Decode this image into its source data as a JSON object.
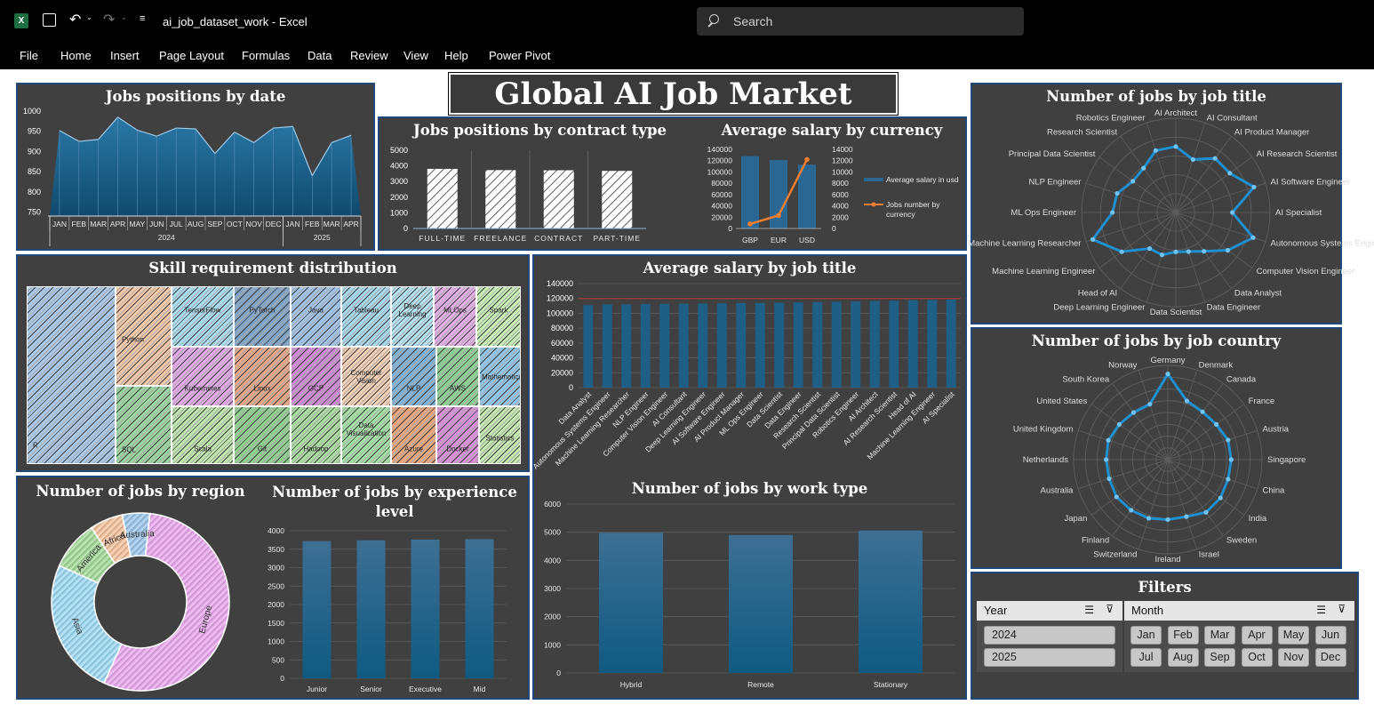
{
  "titlebar": {
    "filename": "ai_job_dataset_work",
    "separator": "-",
    "app": "Excel",
    "search_placeholder": "Search"
  },
  "ribbon": {
    "tabs": [
      "File",
      "Home",
      "Insert",
      "Page Layout",
      "Formulas",
      "Data",
      "Review",
      "View",
      "Help",
      "Power Pivot"
    ]
  },
  "dashboard_title": "Global AI Job Market",
  "panels": {
    "date": "Jobs positions by date",
    "contract": "Jobs positions by contract type",
    "currency": "Average salary by currency",
    "title_radar": "Number of jobs by job title",
    "skills": "Skill requirement distribution",
    "salary_title": "Average salary by job title",
    "country": "Number of jobs by job country",
    "region": "Number of jobs by region",
    "experience": "Number of jobs by experience level",
    "worktype": "Number of jobs by work type",
    "filters": "Filters"
  },
  "slicers": {
    "year": {
      "label": "Year",
      "items": [
        "2024",
        "2025"
      ]
    },
    "month": {
      "label": "Month",
      "items": [
        "Jan",
        "Feb",
        "Mar",
        "Apr",
        "May",
        "Jun",
        "Jul",
        "Aug",
        "Sep",
        "Oct",
        "Nov",
        "Dec"
      ]
    }
  },
  "chart_data": [
    {
      "id": "date",
      "type": "area",
      "title": "Jobs positions by date",
      "categories": [
        "JAN",
        "FEB",
        "MAR",
        "APR",
        "MAY",
        "JUN",
        "JUL",
        "AUG",
        "SEP",
        "OCT",
        "NOV",
        "DEC",
        "JAN",
        "FEB",
        "MAR",
        "APR"
      ],
      "groups": [
        "2024",
        "2025"
      ],
      "values": [
        952,
        925,
        930,
        985,
        953,
        938,
        958,
        956,
        895,
        948,
        922,
        958,
        962,
        840,
        922,
        940
      ],
      "yticks": [
        1000,
        950,
        900,
        850,
        800,
        750
      ],
      "ylim": [
        740,
        1000
      ]
    },
    {
      "id": "contract",
      "type": "bar",
      "title": "Jobs positions by contract type",
      "categories": [
        "FULL-TIME",
        "FREELANCE",
        "CONTRACT",
        "PART-TIME"
      ],
      "values": [
        3810,
        3730,
        3720,
        3680
      ],
      "yticks": [
        5000,
        4000,
        3000,
        2000,
        1000,
        0
      ],
      "ylim": [
        0,
        5000
      ]
    },
    {
      "id": "currency",
      "type": "bar",
      "title": "Average salary by currency",
      "categories": [
        "GBP",
        "EUR",
        "USD"
      ],
      "series": [
        {
          "name": "Average salary in usd",
          "values": [
            128000,
            121000,
            113000
          ]
        },
        {
          "name": "Jobs number by currency",
          "values": [
            800,
            2300,
            12200
          ]
        }
      ],
      "yticks": [
        "140000",
        "120000",
        "100000",
        "80000",
        "60000",
        "40000",
        "20000",
        "0"
      ],
      "y2ticks": [
        "14000",
        "12000",
        "10000",
        "8000",
        "6000",
        "4000",
        "2000",
        "0"
      ],
      "ylim": [
        0,
        140000
      ],
      "y2lim": [
        0,
        14000
      ]
    },
    {
      "id": "title_radar",
      "type": "radar",
      "title": "Number of jobs by job title",
      "categories": [
        "AI Architect",
        "AI Consultant",
        "AI Product Manager",
        "AI Research Scientist",
        "AI Software Engineer",
        "AI Specialist",
        "Autonomous Systems Engineer",
        "Computer Vision Engineer",
        "Data Analyst",
        "Data Engineer",
        "Data Scientist",
        "Deep Learning Engineer",
        "Head of AI",
        "Machine Learning Engineer",
        "Machine Learning Researcher",
        "ML Ops Engineer",
        "NLP Engineer",
        "Principal Data Scientist",
        "Research Scientist",
        "Robotics Engineer"
      ],
      "values": [
        770,
        650,
        780,
        780,
        960,
        660,
        950,
        750,
        560,
        480,
        460,
        520,
        520,
        780,
        1020,
        740,
        720,
        620,
        640,
        760
      ],
      "rmax": 1100
    },
    {
      "id": "skills",
      "type": "treemap",
      "title": "Skill requirement distribution",
      "categories": [
        "R",
        "Python",
        "SQL",
        "TensorFlow",
        "PyTorch",
        "Java",
        "Tableau",
        "Deep Learning",
        "MLOps",
        "Spark",
        "Kubernetes",
        "Linux",
        "GCP",
        "Computer Vision",
        "NLP",
        "AWS",
        "Mathematics",
        "Scala",
        "Git",
        "Hadoop",
        "Data Visualization",
        "Azure",
        "Docker",
        "Statistics"
      ]
    },
    {
      "id": "salary_title",
      "type": "bar",
      "title": "Average salary by job title",
      "categories": [
        "Data Analyst",
        "Autonomous Systems Engineer",
        "Machine Learning Researcher",
        "NLP Engineer",
        "Computer Vision Engineer",
        "AI Consultant",
        "Deep Learning Engineer",
        "AI Software Engineer",
        "AI Product Manager",
        "ML Ops Engineer",
        "Data Scientist",
        "Data Engineer",
        "Research Scientist",
        "Principal Data Scientist",
        "Robotics Engineer",
        "AI Architect",
        "AI Research Scientist",
        "Head of AI",
        "Machine Learning Engineer",
        "AI Specialist"
      ],
      "values": [
        111000,
        112000,
        112200,
        112500,
        112800,
        113000,
        113200,
        113500,
        113800,
        114000,
        114300,
        114600,
        115000,
        115500,
        116000,
        116500,
        117000,
        117500,
        118000,
        118500
      ],
      "yticks": [
        "140000",
        "120000",
        "100000",
        "80000",
        "60000",
        "40000",
        "20000",
        "0"
      ],
      "ylim": [
        0,
        140000
      ]
    },
    {
      "id": "country",
      "type": "radar",
      "title": "Number of jobs by job country",
      "categories": [
        "Germany",
        "Denmark",
        "Canada",
        "France",
        "Austria",
        "Singapore",
        "China",
        "India",
        "Sweden",
        "Israel",
        "Ireland",
        "Switzerland",
        "Finland",
        "Japan",
        "Australia",
        "Netherlands",
        "United Kingdom",
        "United States",
        "South Korea",
        "Norway"
      ],
      "values": [
        1000,
        720,
        690,
        700,
        740,
        740,
        740,
        760,
        760,
        700,
        700,
        720,
        730,
        740,
        720,
        720,
        730,
        700,
        680,
        680
      ],
      "rmax": 1100
    },
    {
      "id": "region",
      "type": "pie",
      "title": "Number of jobs by region",
      "categories": [
        "Europe",
        "Asia",
        "America",
        "Africa",
        "Australia"
      ],
      "values": [
        55,
        25,
        9,
        6,
        5
      ]
    },
    {
      "id": "experience",
      "type": "bar",
      "title": "Number of jobs by experience level",
      "categories": [
        "Junior",
        "Senior",
        "Executive",
        "Mid"
      ],
      "values": [
        3720,
        3740,
        3760,
        3770
      ],
      "yticks": [
        "4000",
        "3500",
        "3000",
        "2500",
        "2000",
        "1500",
        "1000",
        "500",
        "0"
      ],
      "ylim": [
        0,
        4000
      ]
    },
    {
      "id": "worktype",
      "type": "bar",
      "title": "Number of jobs by work type",
      "categories": [
        "Hybrid",
        "Remote",
        "Stationary"
      ],
      "values": [
        4980,
        4900,
        5060
      ],
      "yticks": [
        "6000",
        "5000",
        "4000",
        "3000",
        "2000",
        "1000",
        "0"
      ],
      "ylim": [
        0,
        6000
      ]
    }
  ],
  "colors": {
    "panel_bg": "#404040",
    "bar": "#1f5e85",
    "bar_dark": "#1a4f73",
    "orange": "#ed7d31",
    "grid": "#5d5d5d"
  }
}
